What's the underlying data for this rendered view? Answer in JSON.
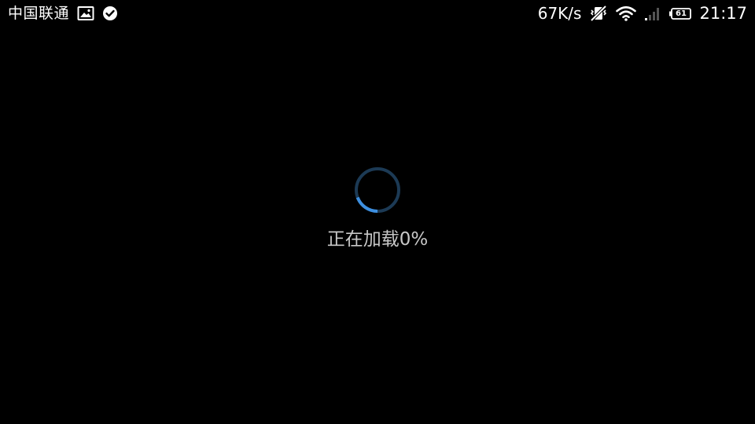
{
  "status_bar": {
    "carrier": "中国联通",
    "net_speed": "67K/s",
    "battery_level": "61",
    "time": "21:17",
    "icons": [
      "image-notification-icon",
      "check-circle-icon",
      "vibrate-off-icon",
      "wifi-icon",
      "signal-icon",
      "battery-icon"
    ]
  },
  "loading": {
    "text": "正在加载0%",
    "progress": 0,
    "accent_color": "#3d8fe0",
    "track_color": "#1c3a55"
  }
}
